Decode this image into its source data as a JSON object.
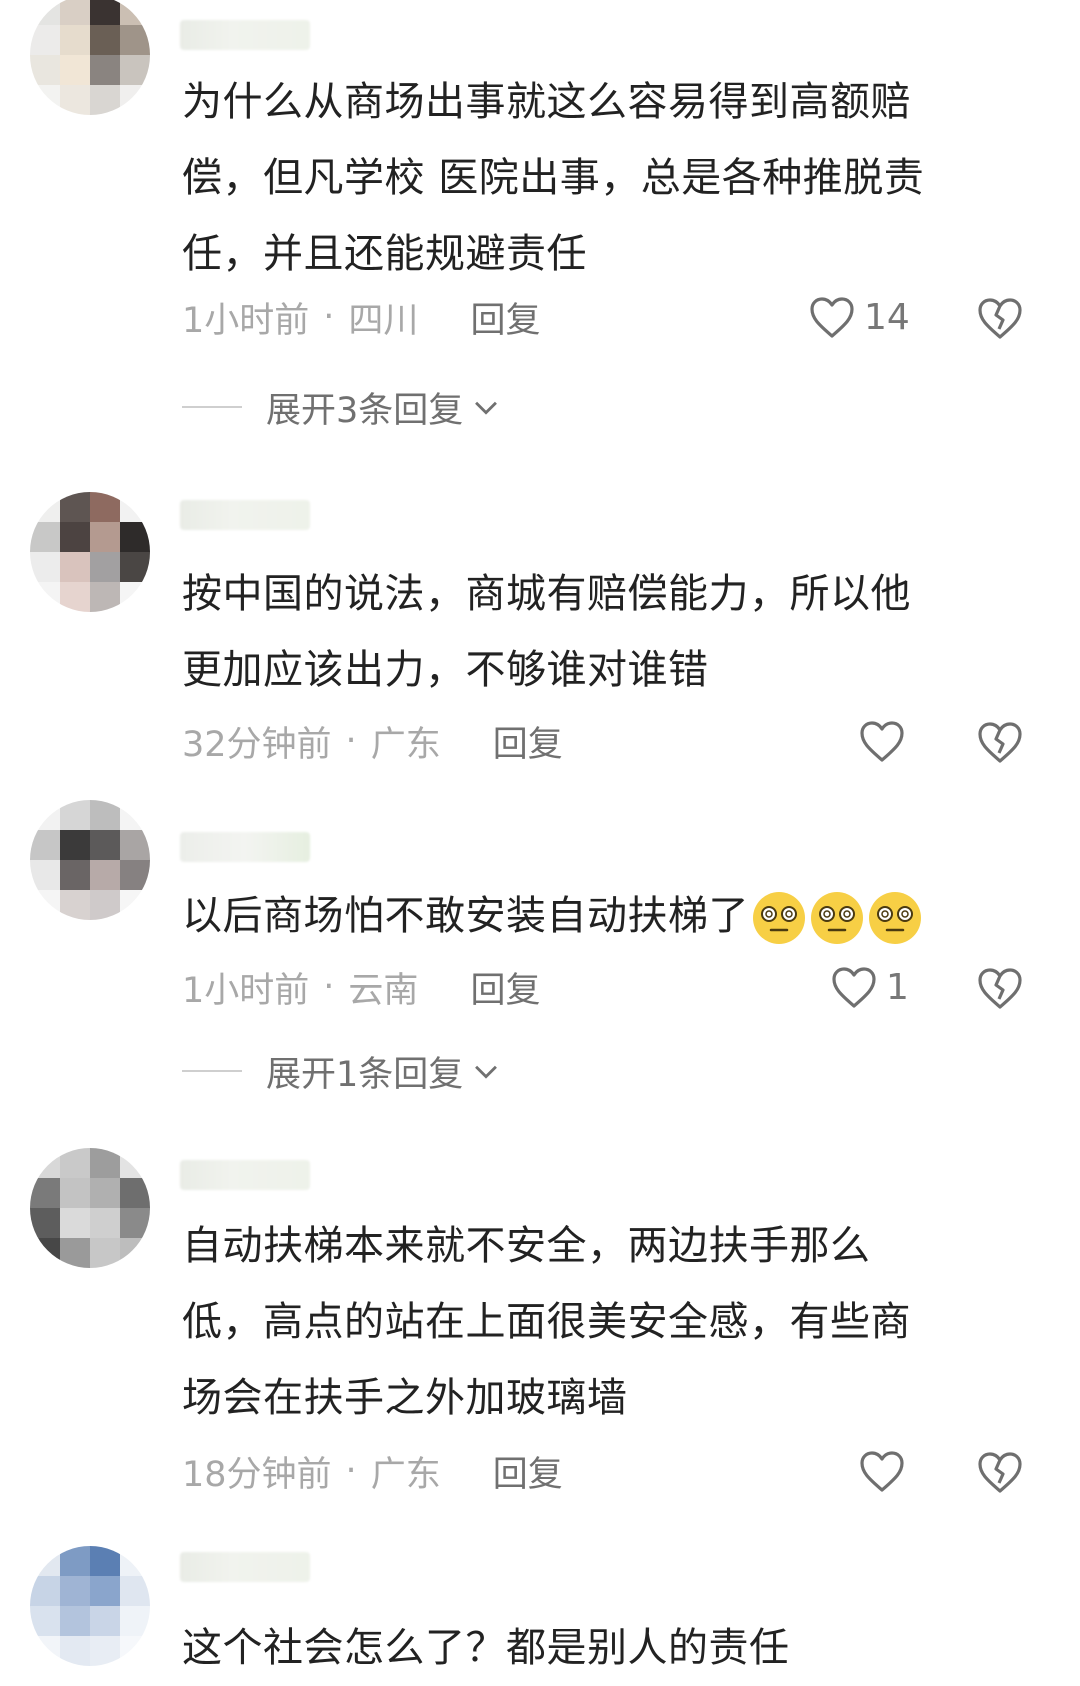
{
  "comments": [
    {
      "text_lines": [
        "为什么从商场出事就这么容易得到高额赔",
        "偿，但凡学校  医院出事，总是各种推脱责",
        "任，并且还能规避责任"
      ],
      "time": "1小时前",
      "location": "四川",
      "reply_label": "回复",
      "likes": "14",
      "expand_label": "展开3条回复"
    },
    {
      "text_lines": [
        "按中国的说法，商城有赔偿能力，所以他",
        "更加应该出力，不够谁对谁错"
      ],
      "time": "32分钟前",
      "location": "广东",
      "reply_label": "回复",
      "likes": ""
    },
    {
      "text_lines": [
        "以后商场怕不敢安装自动扶梯了"
      ],
      "emoji": [
        "dizzy-face-icon",
        "dizzy-face-icon",
        "dizzy-face-icon"
      ],
      "time": "1小时前",
      "location": "云南",
      "reply_label": "回复",
      "likes": "1",
      "expand_label": "展开1条回复"
    },
    {
      "text_lines": [
        "自动扶梯本来就不安全，两边扶手那么",
        "低，高点的站在上面很美安全感，有些商",
        "场会在扶手之外加玻璃墙"
      ],
      "time": "18分钟前",
      "location": "广东",
      "reply_label": "回复",
      "likes": ""
    },
    {
      "text_lines": [
        "这个社会怎么了？都是别人的责任"
      ]
    }
  ],
  "separator": "·",
  "colors": {
    "text": "#222222",
    "meta": "#a8a8a8",
    "reply": "#707070",
    "icon": "#6f6f6f"
  }
}
